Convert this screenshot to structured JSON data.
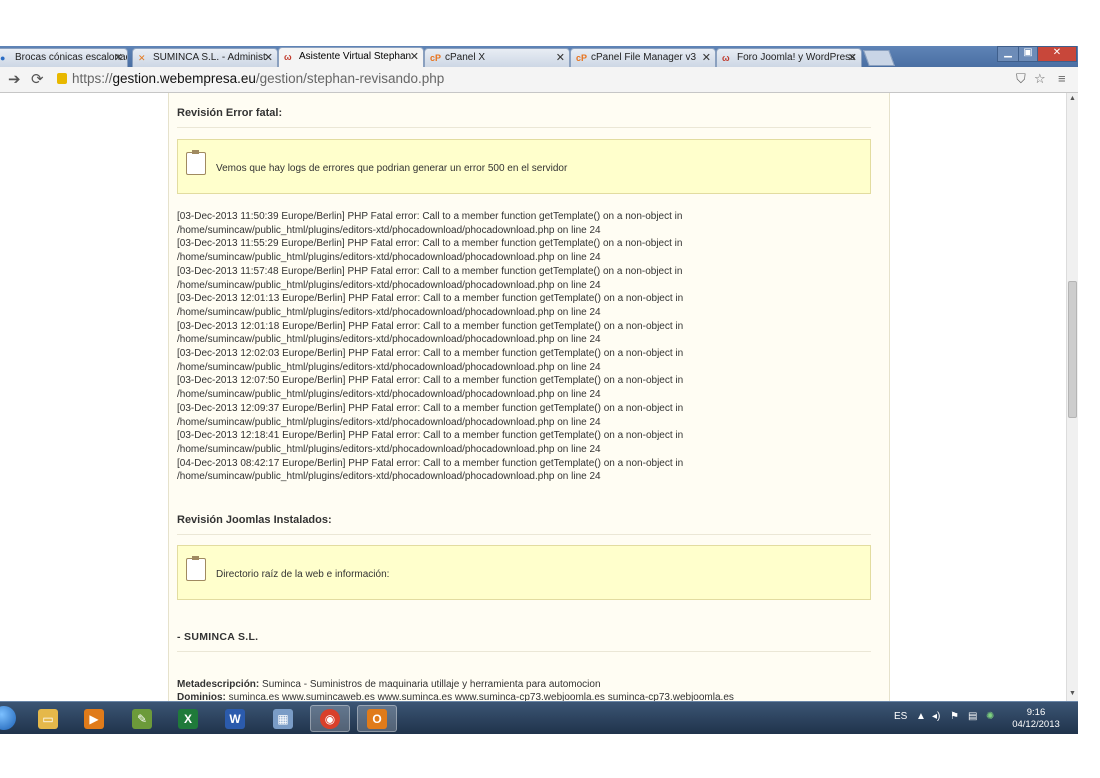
{
  "browser": {
    "tabs": [
      {
        "favicon": "●",
        "favicon_color": "#2b6cc4",
        "label": "Brocas cónicas escalonad"
      },
      {
        "favicon": "✕",
        "favicon_color": "#e57a1f",
        "label": "SUMINCA S.L. - Administ"
      },
      {
        "favicon": "ω",
        "favicon_color": "#c0392b",
        "label": "Asistente Virtual Stephan"
      },
      {
        "favicon": "cP",
        "favicon_color": "#e8731d",
        "label": "cPanel X"
      },
      {
        "favicon": "cP",
        "favicon_color": "#e8731d",
        "label": "cPanel File Manager v3"
      },
      {
        "favicon": "ω",
        "favicon_color": "#c0392b",
        "label": "Foro Joomla! y WordPress"
      }
    ],
    "url_scheme": "https://",
    "url_host": "gestion.webempresa.eu",
    "url_path": "/gestion/stephan-revisando.php"
  },
  "page": {
    "section_error_title": "Revisión Error fatal:",
    "error_notice": "Vemos que hay logs de errores que podrian generar un error 500 en el servidor",
    "log_lines": [
      "[03-Dec-2013 11:50:39 Europe/Berlin] PHP Fatal error: Call to a member function getTemplate() on a non-object in",
      "/home/sumincaw/public_html/plugins/editors-xtd/phocadownload/phocadownload.php on line 24",
      "[03-Dec-2013 11:55:29 Europe/Berlin] PHP Fatal error: Call to a member function getTemplate() on a non-object in",
      "/home/sumincaw/public_html/plugins/editors-xtd/phocadownload/phocadownload.php on line 24",
      "[03-Dec-2013 11:57:48 Europe/Berlin] PHP Fatal error: Call to a member function getTemplate() on a non-object in",
      "/home/sumincaw/public_html/plugins/editors-xtd/phocadownload/phocadownload.php on line 24",
      "[03-Dec-2013 12:01:13 Europe/Berlin] PHP Fatal error: Call to a member function getTemplate() on a non-object in",
      "/home/sumincaw/public_html/plugins/editors-xtd/phocadownload/phocadownload.php on line 24",
      "[03-Dec-2013 12:01:18 Europe/Berlin] PHP Fatal error: Call to a member function getTemplate() on a non-object in",
      "/home/sumincaw/public_html/plugins/editors-xtd/phocadownload/phocadownload.php on line 24",
      "[03-Dec-2013 12:02:03 Europe/Berlin] PHP Fatal error: Call to a member function getTemplate() on a non-object in",
      "/home/sumincaw/public_html/plugins/editors-xtd/phocadownload/phocadownload.php on line 24",
      "[03-Dec-2013 12:07:50 Europe/Berlin] PHP Fatal error: Call to a member function getTemplate() on a non-object in",
      "/home/sumincaw/public_html/plugins/editors-xtd/phocadownload/phocadownload.php on line 24",
      "[03-Dec-2013 12:09:37 Europe/Berlin] PHP Fatal error: Call to a member function getTemplate() on a non-object in",
      "/home/sumincaw/public_html/plugins/editors-xtd/phocadownload/phocadownload.php on line 24",
      "[03-Dec-2013 12:18:41 Europe/Berlin] PHP Fatal error: Call to a member function getTemplate() on a non-object in",
      "/home/sumincaw/public_html/plugins/editors-xtd/phocadownload/phocadownload.php on line 24",
      "[04-Dec-2013 08:42:17 Europe/Berlin] PHP Fatal error: Call to a member function getTemplate() on a non-object in",
      "/home/sumincaw/public_html/plugins/editors-xtd/phocadownload/phocadownload.php on line 24"
    ],
    "section_joomla_title": "Revisión Joomlas Instalados:",
    "joomla_notice": "Directorio raíz de la web e información:",
    "company_title": "- SUMINCA S.L.",
    "meta_label": "Metadescripción:",
    "meta_value": " Suminca - Suministros de maquinaria utillaje y herramienta para automocion",
    "domains_label": "Dominios:",
    "domains_value": " suminca.es www.sumincaweb.es www.suminca.es www.suminca-cp73.webjoomla.es suminca-cp73.webjoomla.es"
  },
  "taskbar": {
    "apps": [
      {
        "name": "explorer-icon",
        "glyph": "▭",
        "color": "#e5b84a"
      },
      {
        "name": "media-player-icon",
        "glyph": "▶",
        "color": "#e07b1a"
      },
      {
        "name": "notepad-icon",
        "glyph": "✎",
        "color": "#6c9a3a"
      },
      {
        "name": "excel-icon",
        "glyph": "X",
        "color": "#1f7a3a"
      },
      {
        "name": "word-icon",
        "glyph": "W",
        "color": "#2b5bad"
      },
      {
        "name": "calculator-icon",
        "glyph": "▦",
        "color": "#7a9cc6"
      },
      {
        "name": "chrome-icon",
        "glyph": "◉",
        "color": "#d9402b"
      },
      {
        "name": "outlook-icon",
        "glyph": "O",
        "color": "#e07b1a"
      }
    ],
    "language": "ES",
    "time": "9:16",
    "date": "04/12/2013"
  }
}
